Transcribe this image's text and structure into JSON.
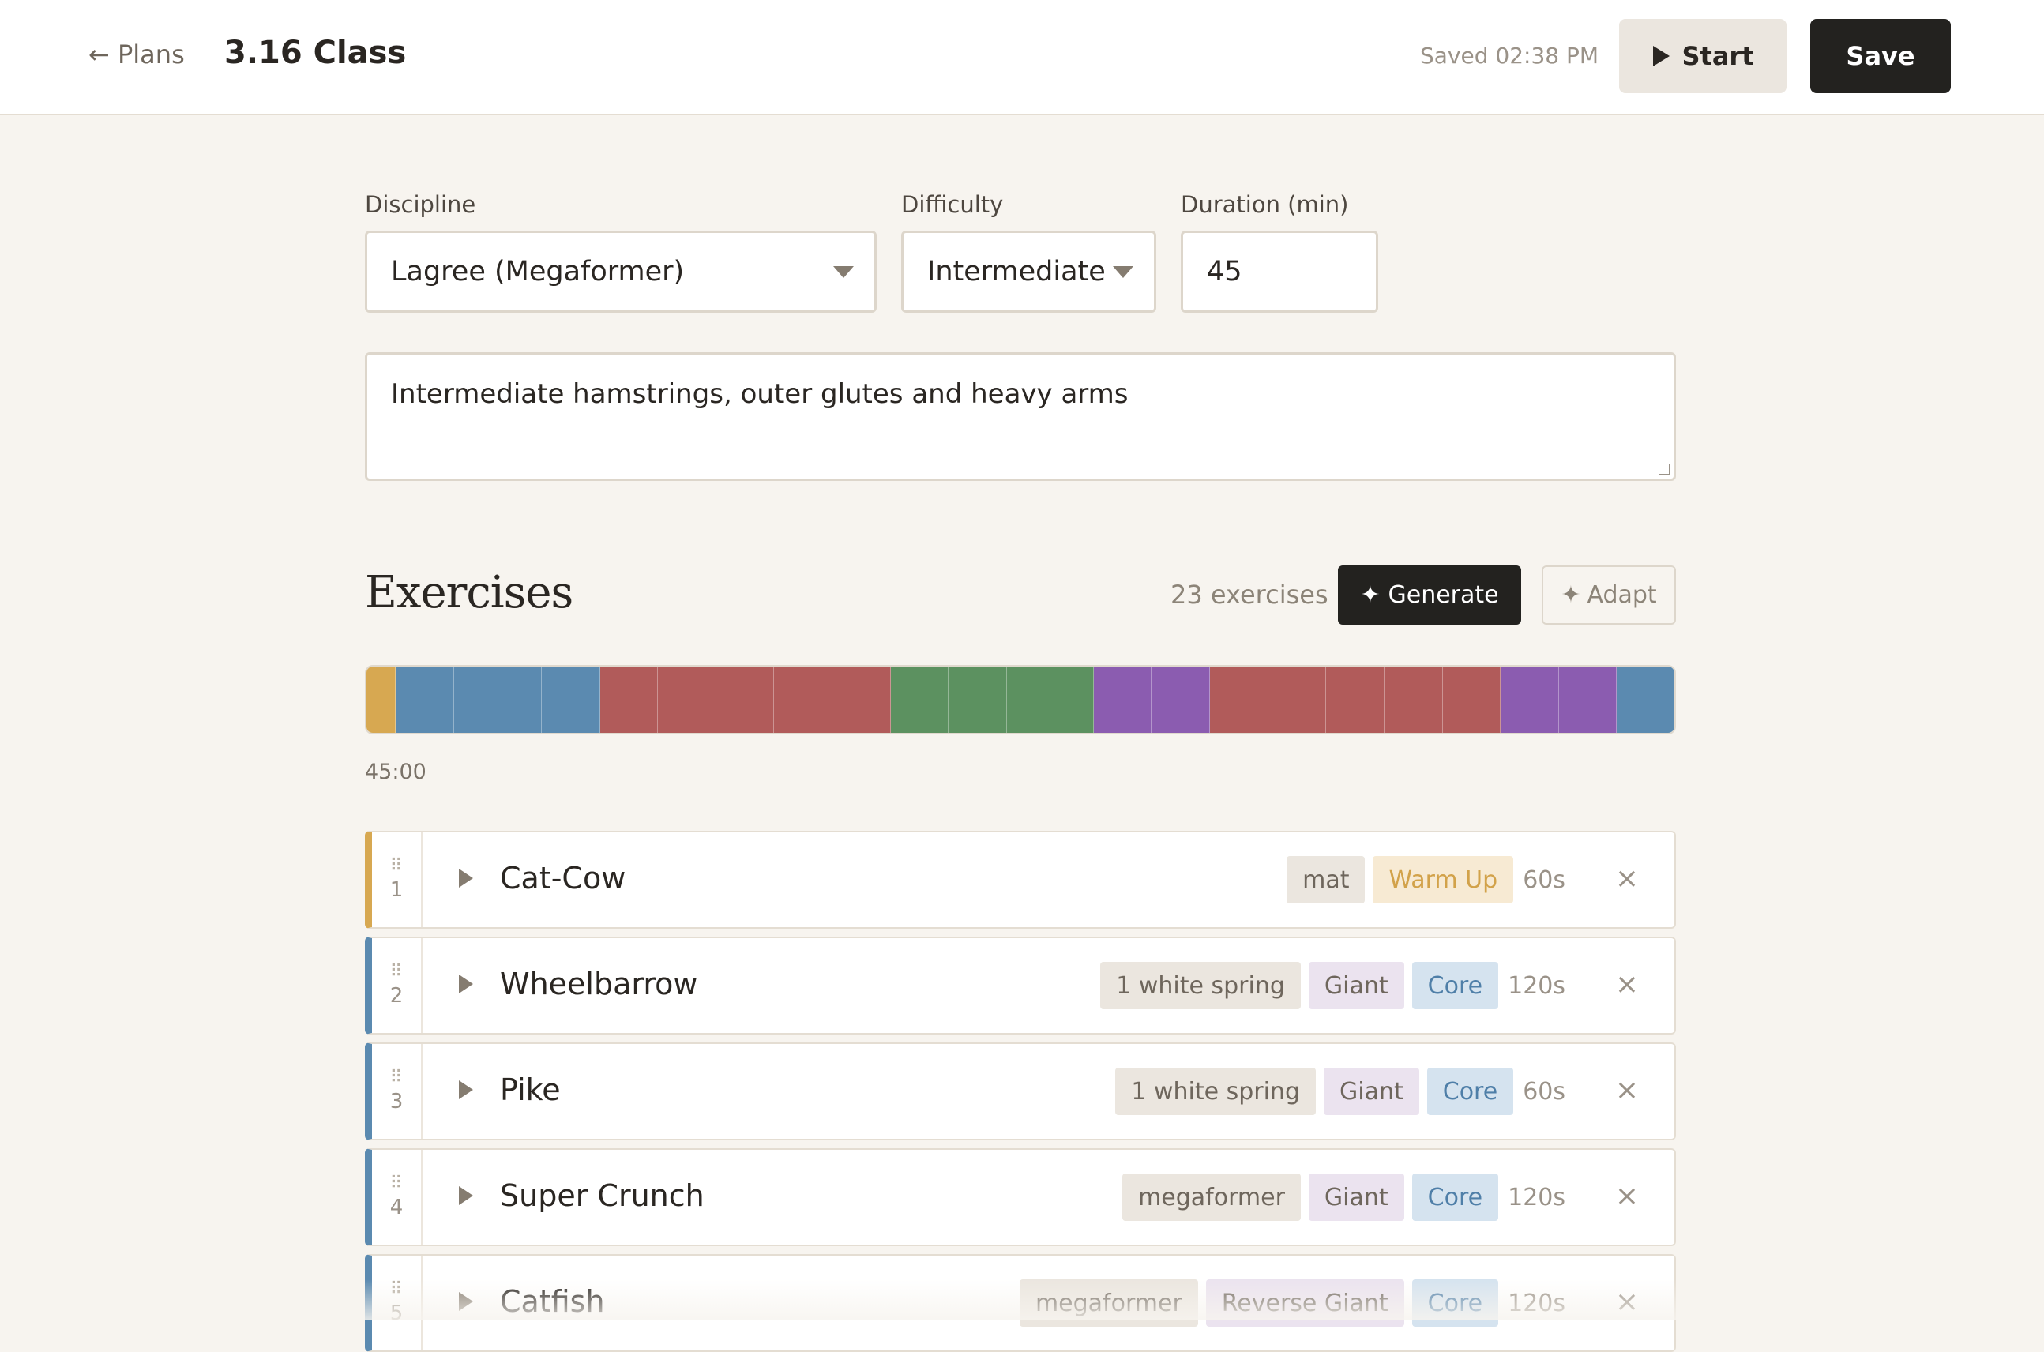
{
  "header": {
    "back_label": "← Plans",
    "title": "3.16 Class",
    "saved_status": "Saved 02:38 PM",
    "start_label": "Start",
    "save_label": "Save"
  },
  "form": {
    "discipline_label": "Discipline",
    "discipline_value": "Lagree (Megaformer)",
    "difficulty_label": "Difficulty",
    "difficulty_value": "Intermediate",
    "duration_label": "Duration (min)",
    "duration_value": "45",
    "description": "Intermediate hamstrings, outer glutes and heavy arms"
  },
  "exercises_section": {
    "title": "Exercises",
    "count_label": "23 exercises",
    "generate_label": "Generate",
    "adapt_label": "Adapt"
  },
  "timeline": {
    "total_label": "45:00",
    "colors": {
      "warmup": "#d7a851",
      "core": "#5b8ab0",
      "legs": "#b15b5a",
      "glutes": "#5c9160",
      "arms": "#8b5cb0"
    },
    "segments": [
      {
        "group": "warmup",
        "seconds": 60
      },
      {
        "group": "core",
        "seconds": 120
      },
      {
        "group": "core",
        "seconds": 60
      },
      {
        "group": "core",
        "seconds": 120
      },
      {
        "group": "core",
        "seconds": 120
      },
      {
        "group": "legs",
        "seconds": 120
      },
      {
        "group": "legs",
        "seconds": 120
      },
      {
        "group": "legs",
        "seconds": 120
      },
      {
        "group": "legs",
        "seconds": 120
      },
      {
        "group": "legs",
        "seconds": 120
      },
      {
        "group": "glutes",
        "seconds": 120
      },
      {
        "group": "glutes",
        "seconds": 120
      },
      {
        "group": "glutes",
        "seconds": 180
      },
      {
        "group": "arms",
        "seconds": 120
      },
      {
        "group": "arms",
        "seconds": 120
      },
      {
        "group": "legs",
        "seconds": 120
      },
      {
        "group": "legs",
        "seconds": 120
      },
      {
        "group": "legs",
        "seconds": 120
      },
      {
        "group": "legs",
        "seconds": 120
      },
      {
        "group": "legs",
        "seconds": 120
      },
      {
        "group": "arms",
        "seconds": 120
      },
      {
        "group": "arms",
        "seconds": 120
      },
      {
        "group": "core",
        "seconds": 120
      }
    ]
  },
  "exercises": [
    {
      "index": "1",
      "name": "Cat-Cow",
      "group_color": "#d7a851",
      "tags": [
        {
          "label": "mat",
          "kind": "equip"
        },
        {
          "label": "Warm Up",
          "kind": "warm"
        }
      ],
      "duration": "60s"
    },
    {
      "index": "2",
      "name": "Wheelbarrow",
      "group_color": "#5b8ab0",
      "tags": [
        {
          "label": "1 white spring",
          "kind": "equip"
        },
        {
          "label": "Giant",
          "kind": "pos"
        },
        {
          "label": "Core",
          "kind": "core"
        }
      ],
      "duration": "120s"
    },
    {
      "index": "3",
      "name": "Pike",
      "group_color": "#5b8ab0",
      "tags": [
        {
          "label": "1 white spring",
          "kind": "equip"
        },
        {
          "label": "Giant",
          "kind": "pos"
        },
        {
          "label": "Core",
          "kind": "core"
        }
      ],
      "duration": "60s"
    },
    {
      "index": "4",
      "name": "Super Crunch",
      "group_color": "#5b8ab0",
      "tags": [
        {
          "label": "megaformer",
          "kind": "equip"
        },
        {
          "label": "Giant",
          "kind": "pos"
        },
        {
          "label": "Core",
          "kind": "core"
        }
      ],
      "duration": "120s"
    },
    {
      "index": "5",
      "name": "Catfish",
      "group_color": "#5b8ab0",
      "tags": [
        {
          "label": "megaformer",
          "kind": "equip"
        },
        {
          "label": "Reverse Giant",
          "kind": "pos"
        },
        {
          "label": "Core",
          "kind": "core"
        }
      ],
      "duration": "120s"
    }
  ],
  "icons": {
    "play": "play-icon",
    "sparkle": "sparkle-icon",
    "drag": "drag-handle-icon",
    "expand": "chevron-right-icon",
    "remove": "close-icon",
    "caret": "chevron-down-icon",
    "back": "arrow-left-icon"
  },
  "colors": {
    "page_background": "#f7f4ef",
    "primary_button": "#23221f",
    "secondary_button": "#ebe6df"
  }
}
